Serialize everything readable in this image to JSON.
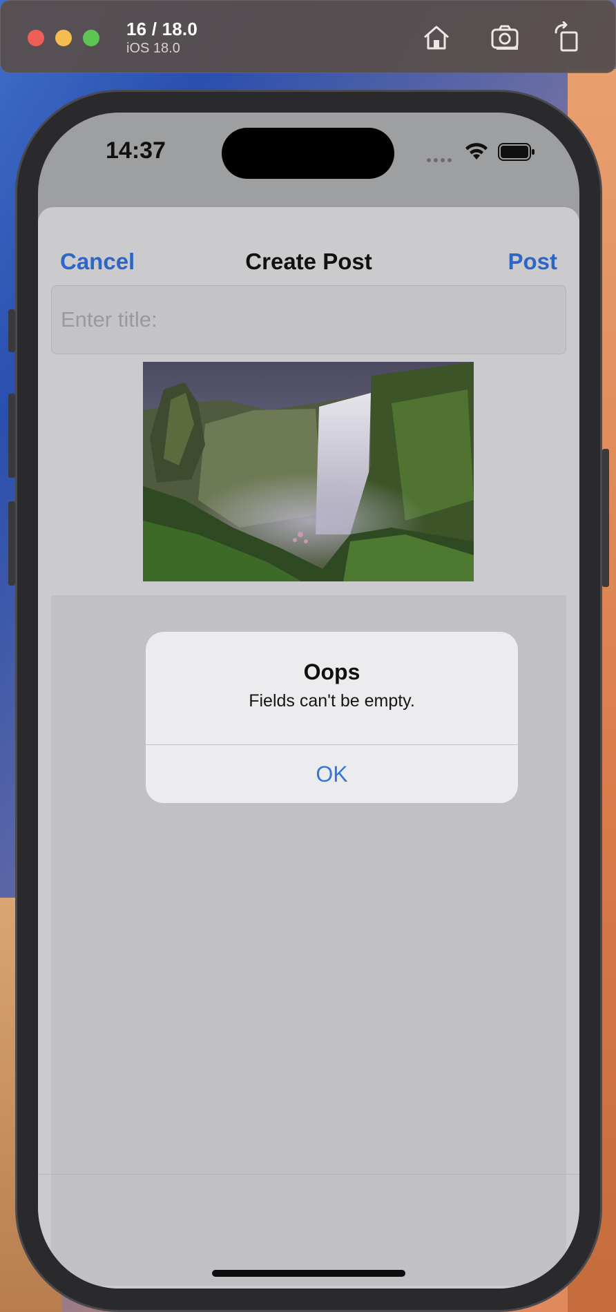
{
  "simulator": {
    "device_title": "16 / 18.0",
    "os_label": "iOS 18.0",
    "buttons": [
      "home-icon",
      "screenshot-icon",
      "rotate-icon"
    ]
  },
  "status_bar": {
    "time": "14:37"
  },
  "nav": {
    "cancel_label": "Cancel",
    "title": "Create Post",
    "post_label": "Post"
  },
  "form": {
    "title_placeholder": "Enter title:",
    "title_value": ""
  },
  "alert": {
    "title": "Oops",
    "message": "Fields can't be empty.",
    "ok_label": "OK"
  },
  "colors": {
    "accent": "#2c66c8",
    "alert_button": "#3478d6",
    "sheet_background": "#cbcbcd",
    "alert_background": "#ececee"
  }
}
